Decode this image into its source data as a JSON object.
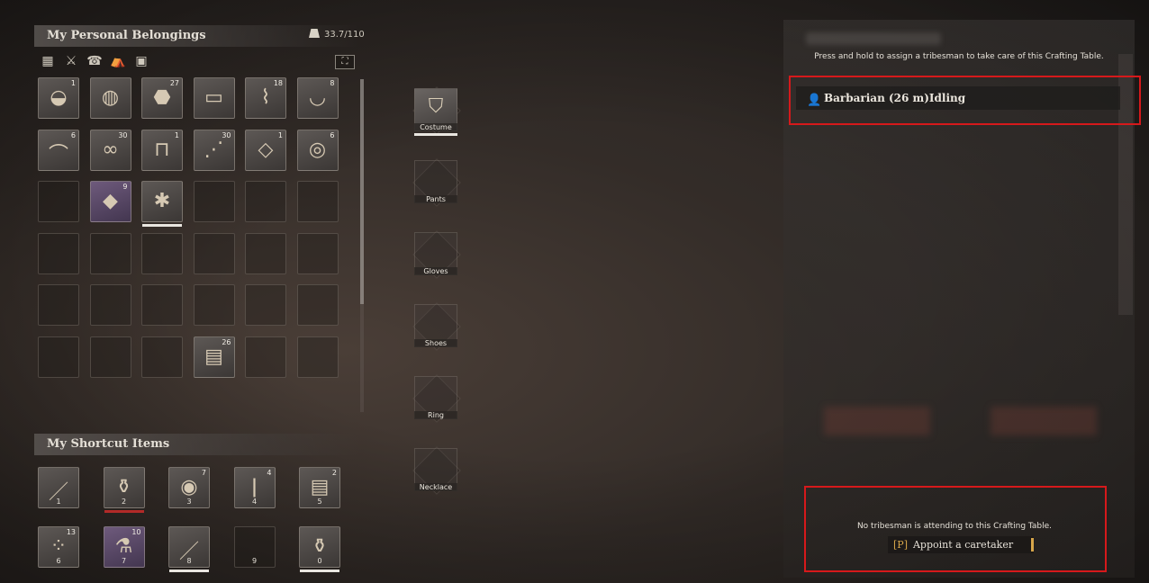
{
  "inventory": {
    "title": "My Personal Belongings",
    "weight": "33.7/110",
    "sort_icon": "expand-icon",
    "category_icons": [
      "materials-icon",
      "weapons-icon",
      "armor-icon",
      "tent-icon",
      "documents-icon"
    ],
    "slots": [
      {
        "icon": "stone-icon",
        "glyph": "◒",
        "qty": "1"
      },
      {
        "icon": "spool-icon",
        "glyph": "◍",
        "qty": ""
      },
      {
        "icon": "rock-icon",
        "glyph": "⬣",
        "qty": "27"
      },
      {
        "icon": "plank-icon",
        "glyph": "▭",
        "qty": ""
      },
      {
        "icon": "fiber-icon",
        "glyph": "⌇",
        "qty": "18"
      },
      {
        "icon": "bowl-icon",
        "glyph": "◡",
        "qty": "8"
      },
      {
        "icon": "pepper-icon",
        "glyph": "⌒",
        "qty": "6"
      },
      {
        "icon": "rope-icon",
        "glyph": "∞",
        "qty": "30"
      },
      {
        "icon": "stool-icon",
        "glyph": "⊓",
        "qty": "1"
      },
      {
        "icon": "grass-icon",
        "glyph": "⋰",
        "qty": "30"
      },
      {
        "icon": "cloth-icon",
        "glyph": "◇",
        "qty": "1"
      },
      {
        "icon": "rope-coil-icon",
        "glyph": "◎",
        "qty": "6"
      },
      {
        "icon": "empty",
        "glyph": "",
        "qty": ""
      },
      {
        "icon": "ore-icon",
        "glyph": "◆",
        "qty": "9",
        "purple": true
      },
      {
        "icon": "bundle-icon",
        "glyph": "✱",
        "qty": "",
        "underline": true
      },
      {
        "icon": "empty",
        "glyph": "",
        "qty": ""
      },
      {
        "icon": "empty",
        "glyph": "",
        "qty": ""
      },
      {
        "icon": "empty",
        "glyph": "",
        "qty": ""
      },
      {
        "icon": "empty",
        "glyph": "",
        "qty": ""
      },
      {
        "icon": "empty",
        "glyph": "",
        "qty": ""
      },
      {
        "icon": "empty",
        "glyph": "",
        "qty": ""
      },
      {
        "icon": "empty",
        "glyph": "",
        "qty": ""
      },
      {
        "icon": "empty",
        "glyph": "",
        "qty": ""
      },
      {
        "icon": "empty",
        "glyph": "",
        "qty": ""
      },
      {
        "icon": "empty",
        "glyph": "",
        "qty": ""
      },
      {
        "icon": "empty",
        "glyph": "",
        "qty": ""
      },
      {
        "icon": "empty",
        "glyph": "",
        "qty": ""
      },
      {
        "icon": "empty",
        "glyph": "",
        "qty": ""
      },
      {
        "icon": "empty",
        "glyph": "",
        "qty": ""
      },
      {
        "icon": "empty",
        "glyph": "",
        "qty": ""
      },
      {
        "icon": "empty",
        "glyph": "",
        "qty": ""
      },
      {
        "icon": "empty",
        "glyph": "",
        "qty": ""
      },
      {
        "icon": "empty",
        "glyph": "",
        "qty": ""
      },
      {
        "icon": "bark-icon",
        "glyph": "▤",
        "qty": "26"
      },
      {
        "icon": "empty",
        "glyph": "",
        "qty": ""
      },
      {
        "icon": "empty",
        "glyph": "",
        "qty": ""
      },
      {
        "icon": "empty",
        "glyph": "",
        "qty": ""
      },
      {
        "icon": "empty",
        "glyph": "",
        "qty": ""
      },
      {
        "icon": "empty",
        "glyph": "",
        "qty": ""
      },
      {
        "icon": "empty",
        "glyph": "",
        "qty": ""
      },
      {
        "icon": "empty",
        "glyph": "",
        "qty": ""
      },
      {
        "icon": "empty",
        "glyph": "",
        "qty": ""
      }
    ]
  },
  "shortcuts": {
    "title": "My Shortcut Items",
    "slots": [
      {
        "icon": "spear-icon",
        "glyph": "／",
        "qty": "",
        "key": "1"
      },
      {
        "icon": "jug-icon",
        "glyph": "⚱",
        "qty": "",
        "key": "2",
        "red": true
      },
      {
        "icon": "food-bowl-icon",
        "glyph": "◉",
        "qty": "7",
        "key": "3"
      },
      {
        "icon": "torch-icon",
        "glyph": "ǀ",
        "qty": "4",
        "key": "4"
      },
      {
        "icon": "bark-icon",
        "glyph": "▤",
        "qty": "2",
        "key": "5"
      },
      {
        "icon": "seeds-icon",
        "glyph": "⁘",
        "qty": "13",
        "key": "6"
      },
      {
        "icon": "potion-icon",
        "glyph": "⚗",
        "qty": "10",
        "key": "7",
        "purple": true
      },
      {
        "icon": "spear-icon",
        "glyph": "／",
        "qty": "",
        "key": "8",
        "underline": true
      },
      {
        "icon": "empty",
        "glyph": "",
        "qty": "",
        "key": "9"
      },
      {
        "icon": "vase-icon",
        "glyph": "⚱",
        "qty": "",
        "key": "0",
        "underline": true
      }
    ]
  },
  "equipment": [
    {
      "label": "Costume",
      "icon": "costume-icon",
      "glyph": "⛉",
      "filled": true
    },
    {
      "label": "Pants",
      "icon": "pants-icon",
      "glyph": "",
      "filled": false
    },
    {
      "label": "Gloves",
      "icon": "gloves-icon",
      "glyph": "",
      "filled": false
    },
    {
      "label": "Shoes",
      "icon": "shoes-icon",
      "glyph": "",
      "filled": false
    },
    {
      "label": "Ring",
      "icon": "ring-icon",
      "glyph": "",
      "filled": false
    },
    {
      "label": "Necklace",
      "icon": "necklace-icon",
      "glyph": "",
      "filled": false
    }
  ],
  "caretaker": {
    "hint": "Press and hold to assign a tribesman to take care of this Crafting Table.",
    "tribesman": "Barbarian (26 m)Idling",
    "tribesman_icon": "person-icon",
    "notice": "No tribesman is attending to this Crafting Table.",
    "appoint_key": "[P]",
    "appoint_label": "Appoint a caretaker"
  },
  "colors": {
    "highlight_box": "#d6191b",
    "accent_key": "#d7a64a",
    "shortcut_alert": "#b22a28"
  }
}
